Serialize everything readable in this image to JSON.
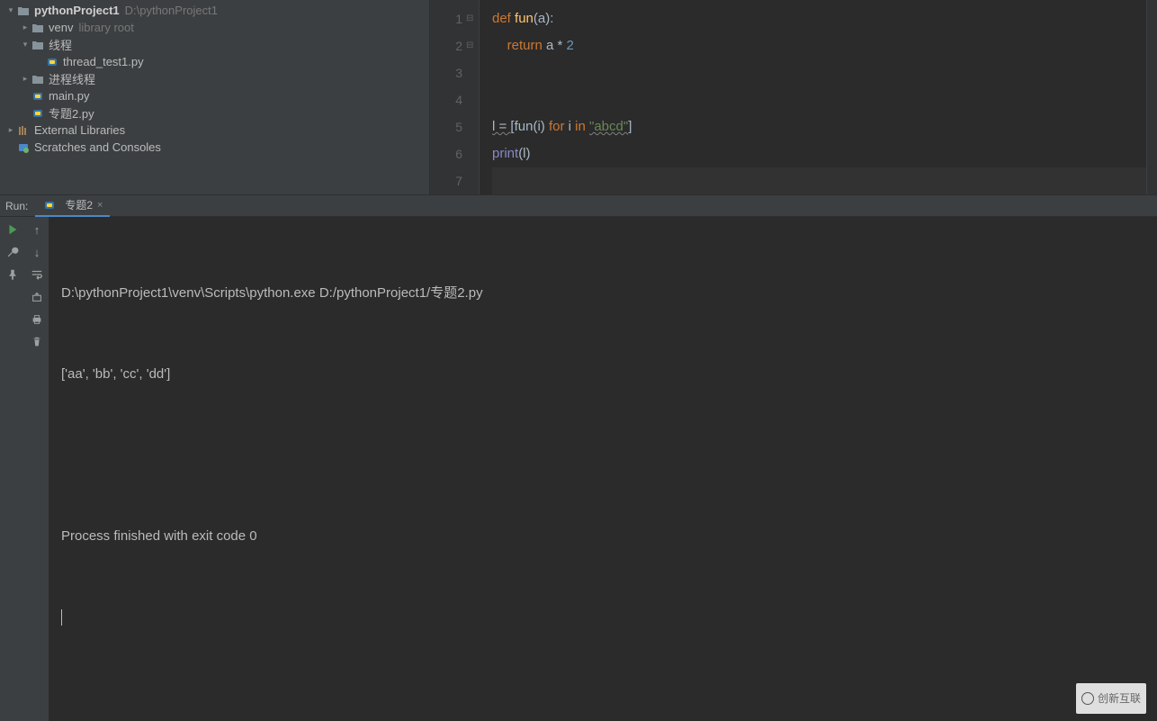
{
  "project": {
    "name": "pythonProject1",
    "path": "D:\\pythonProject1",
    "venv": "venv",
    "venv_hint": "library root",
    "folder1": "线程",
    "file1": "thread_test1.py",
    "folder2": "进程线程",
    "file_main": "main.py",
    "file_topic": "专题2.py",
    "external": "External Libraries",
    "scratches": "Scratches and Consoles"
  },
  "editor": {
    "lines": [
      "1",
      "2",
      "3",
      "4",
      "5",
      "6",
      "7"
    ],
    "code": {
      "l1_def": "def ",
      "l1_fn": "fun",
      "l1_rest": "(a):",
      "l2_ret": "    return ",
      "l2_expr": "a * ",
      "l2_num": "2",
      "l5_a": "l = [",
      "l5_fn": "fun",
      "l5_b": "(i) ",
      "l5_for": "for ",
      "l5_c": "i ",
      "l5_in": "in ",
      "l5_str": "\"abcd\"",
      "l5_d": "]",
      "l6_print": "print",
      "l6_arg": "(l)"
    }
  },
  "run": {
    "label": "Run:",
    "tab": "专题2",
    "line1": "D:\\pythonProject1\\venv\\Scripts\\python.exe D:/pythonProject1/专题2.py",
    "line2": "['aa', 'bb', 'cc', 'dd']",
    "line3": "",
    "line4": "Process finished with exit code 0"
  },
  "watermark": "创新互联"
}
